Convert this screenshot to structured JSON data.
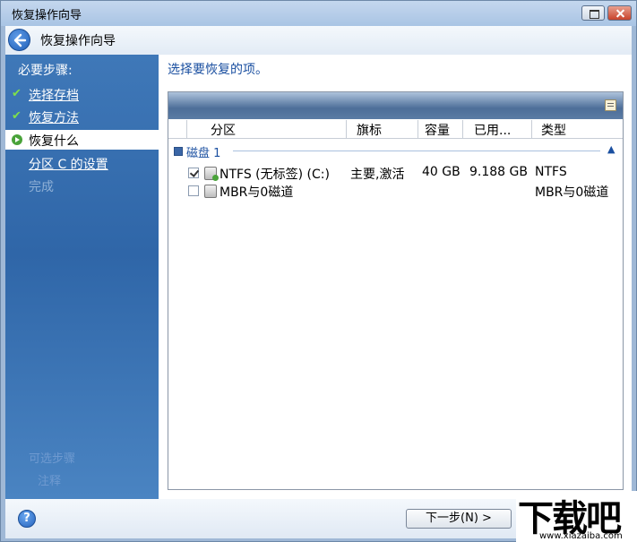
{
  "window": {
    "title": "恢复操作向导"
  },
  "header": {
    "title": "恢复操作向导"
  },
  "sidebar": {
    "heading": "必要步骤:",
    "items": [
      {
        "label": "选择存档",
        "state": "done"
      },
      {
        "label": "恢复方法",
        "state": "done"
      },
      {
        "label": "恢复什么",
        "state": "active"
      },
      {
        "label": "分区 C 的设置",
        "state": "link"
      },
      {
        "label": "完成",
        "state": "disabled"
      }
    ],
    "faded": [
      "可选步骤",
      "注释"
    ]
  },
  "main": {
    "prompt": "选择要恢复的项。",
    "columns": [
      "分区",
      "旗标",
      "容量",
      "已用...",
      "类型"
    ],
    "group": {
      "name": "磁盘 1"
    },
    "rows": [
      {
        "checked": true,
        "name": "NTFS (无标签) (C:)",
        "flags": "主要,激活",
        "size": "40 GB",
        "used": "9.188 GB",
        "type": "NTFS"
      },
      {
        "checked": false,
        "name": "MBR与0磁道",
        "flags": "",
        "size": "",
        "used": "",
        "type": "MBR与0磁道"
      }
    ]
  },
  "footer": {
    "help": "?",
    "next": "下一步(N) >"
  },
  "logo": {
    "big": "下载吧",
    "small": "www.xiazaiba.com"
  }
}
